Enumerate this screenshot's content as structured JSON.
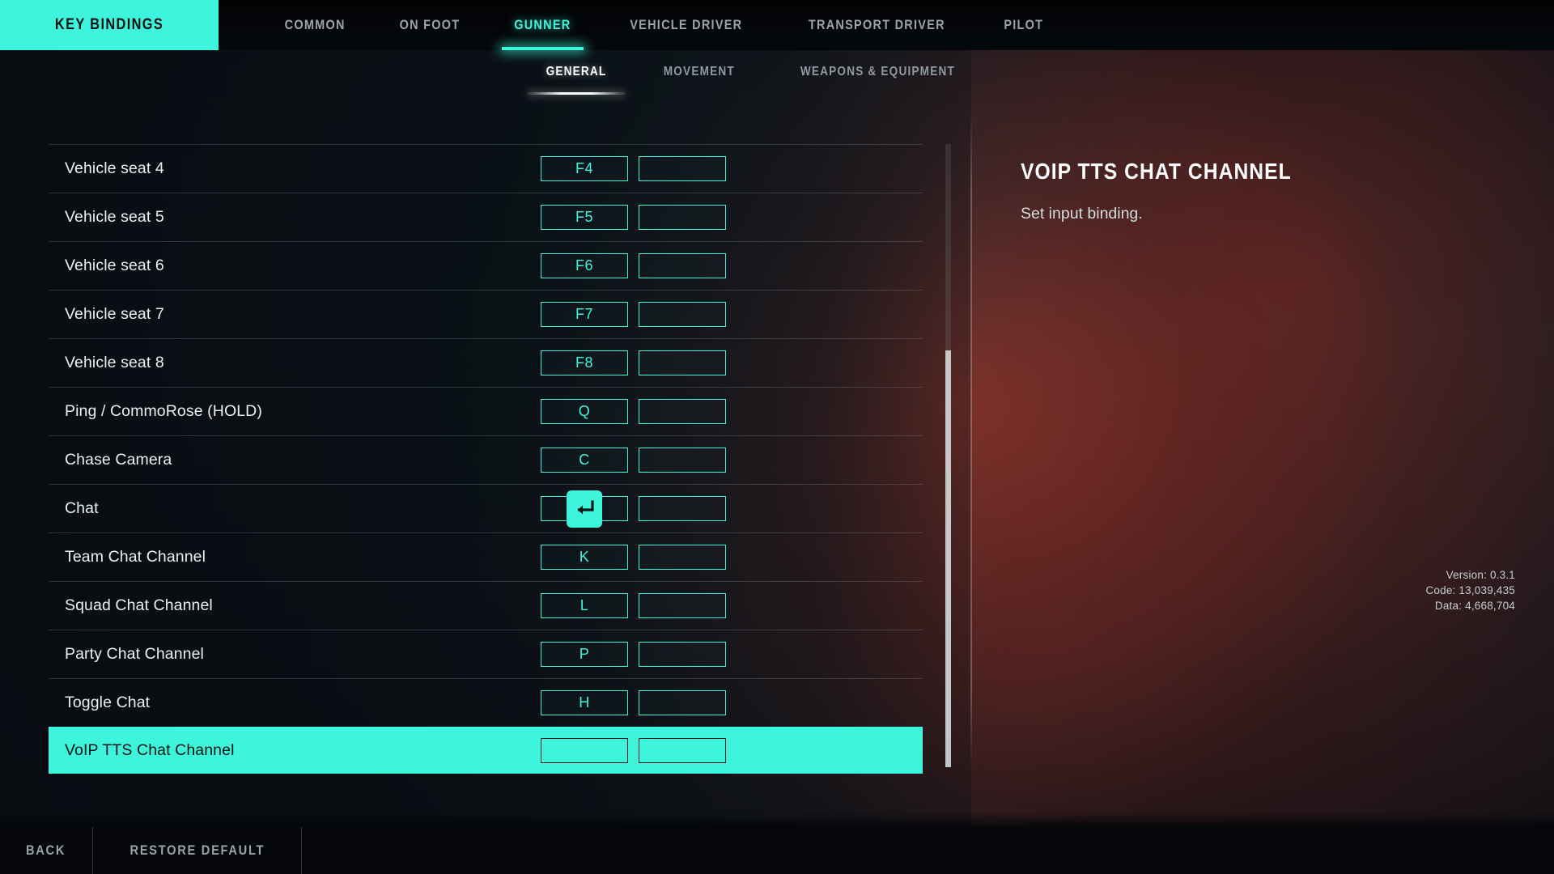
{
  "header": {
    "title": "KEY BINDINGS",
    "category_tabs": [
      {
        "label": "COMMON",
        "active": false
      },
      {
        "label": "ON FOOT",
        "active": false
      },
      {
        "label": "GUNNER",
        "active": true
      },
      {
        "label": "VEHICLE DRIVER",
        "active": false
      },
      {
        "label": "TRANSPORT DRIVER",
        "active": false
      },
      {
        "label": "PILOT",
        "active": false
      }
    ],
    "sub_tabs": [
      {
        "label": "GENERAL",
        "active": true
      },
      {
        "label": "MOVEMENT",
        "active": false
      },
      {
        "label": "WEAPONS & EQUIPMENT",
        "active": false
      }
    ]
  },
  "bindings": [
    {
      "label": "Vehicle seat 4",
      "primary": "F4",
      "secondary": "",
      "selected": false
    },
    {
      "label": "Vehicle seat 5",
      "primary": "F5",
      "secondary": "",
      "selected": false
    },
    {
      "label": "Vehicle seat 6",
      "primary": "F6",
      "secondary": "",
      "selected": false
    },
    {
      "label": "Vehicle seat 7",
      "primary": "F7",
      "secondary": "",
      "selected": false
    },
    {
      "label": "Vehicle seat 8",
      "primary": "F8",
      "secondary": "",
      "selected": false
    },
    {
      "label": "Ping / CommoRose (HOLD)",
      "primary": "Q",
      "secondary": "",
      "selected": false
    },
    {
      "label": "Chase Camera",
      "primary": "C",
      "secondary": "",
      "selected": false
    },
    {
      "label": "Chat",
      "primary": "enter-key",
      "secondary": "",
      "selected": false
    },
    {
      "label": "Team Chat Channel",
      "primary": "K",
      "secondary": "",
      "selected": false
    },
    {
      "label": "Squad Chat Channel",
      "primary": "L",
      "secondary": "",
      "selected": false
    },
    {
      "label": "Party Chat Channel",
      "primary": "P",
      "secondary": "",
      "selected": false
    },
    {
      "label": "Toggle Chat",
      "primary": "H",
      "secondary": "",
      "selected": false
    },
    {
      "label": "VoIP TTS Chat Channel",
      "primary": "",
      "secondary": "",
      "selected": true
    }
  ],
  "detail": {
    "title": "VOIP TTS CHAT CHANNEL",
    "description": "Set input binding."
  },
  "version": {
    "version_line": "Version: 0.3.1",
    "code_line": "Code: 13,039,435",
    "data_line": "Data: 4,668,704"
  },
  "bottom_bar": {
    "back_label": "BACK",
    "restore_label": "RESTORE DEFAULT"
  },
  "colors": {
    "accent": "#3df5dc",
    "panel_bg": "#0b1016",
    "text_primary": "#e8f1f4",
    "text_muted": "#9aa5ad"
  }
}
